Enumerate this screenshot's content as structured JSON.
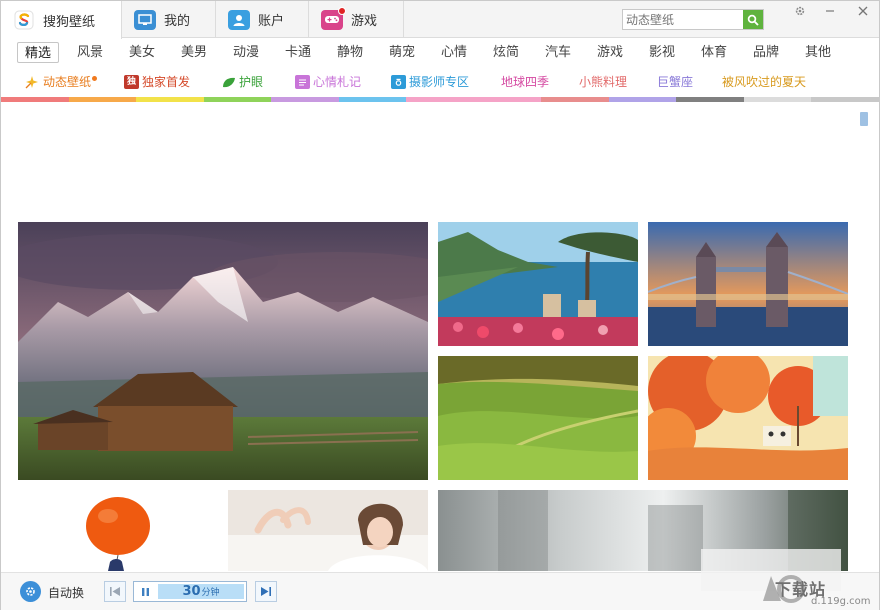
{
  "tabs": [
    {
      "label": "搜狗壁纸",
      "icon": "sogou-logo-icon",
      "active": true
    },
    {
      "label": "我的",
      "icon": "monitor-icon",
      "active": false
    },
    {
      "label": "账户",
      "icon": "user-icon",
      "active": false
    },
    {
      "label": "游戏",
      "icon": "gamepad-icon",
      "active": false,
      "has_notification": true
    }
  ],
  "search": {
    "placeholder": "动态壁纸"
  },
  "window_controls": {
    "settings": "settings-icon",
    "minimize": "minimize-icon",
    "close": "close-icon"
  },
  "categories": [
    "精选",
    "风景",
    "美女",
    "美男",
    "动漫",
    "卡通",
    "静物",
    "萌宠",
    "心情",
    "炫简",
    "汽车",
    "游戏",
    "影视",
    "体育",
    "品牌",
    "其他"
  ],
  "active_category": "精选",
  "topics": [
    {
      "label": "动态壁纸",
      "icon": "sparkle-icon",
      "color": "#e87d1e",
      "is_new": true
    },
    {
      "label": "独家首发",
      "icon": "exclusive-icon",
      "color": "#d54a2a"
    },
    {
      "label": "护眼",
      "icon": "leaf-icon",
      "color": "#3aa23a"
    },
    {
      "label": "心情札记",
      "icon": "notebook-icon",
      "color": "#c874d8"
    },
    {
      "label": "摄影师专区",
      "icon": "camera-icon",
      "color": "#2d9bd8"
    },
    {
      "label": "地球四季",
      "icon": "",
      "color": "#d54aa2"
    },
    {
      "label": "小熊料理",
      "icon": "",
      "color": "#e26a6a"
    },
    {
      "label": "巨蟹座",
      "icon": "",
      "color": "#8a7ad8"
    },
    {
      "label": "被风吹过的夏天",
      "icon": "",
      "color": "#d89a1e"
    }
  ],
  "topic_colors": [
    "#f07b7b",
    "#f7a94a",
    "#f2e24a",
    "#8fd35a",
    "#c89ae0",
    "#6cc3ee",
    "#f5a3c7",
    "#f5a3c7",
    "#e88d8d",
    "#b0a3e8",
    "#808080",
    "#dcdcdc",
    "#c8c8c8"
  ],
  "wallpapers": [
    {
      "name": "grand-teton-barn",
      "subject": "mountain barn at sunset"
    },
    {
      "name": "amalfi-coast",
      "subject": "coastal cliff with tree and flowers"
    },
    {
      "name": "tower-bridge",
      "subject": "tower bridge london at dusk"
    },
    {
      "name": "green-hills",
      "subject": "rolling green fields"
    },
    {
      "name": "autumn-anime",
      "subject": "orange autumn trees illustration"
    },
    {
      "name": "balloon-kid",
      "subject": "red balloon illustration"
    },
    {
      "name": "lying-woman",
      "subject": "woman lying on bed"
    },
    {
      "name": "blurred-room",
      "subject": "blurred window interior"
    }
  ],
  "bottom": {
    "auto_label": "自动换",
    "interval_value": "30",
    "interval_unit": "分钟"
  },
  "watermark": {
    "text": "下载站",
    "sub": "d.119g.com"
  }
}
